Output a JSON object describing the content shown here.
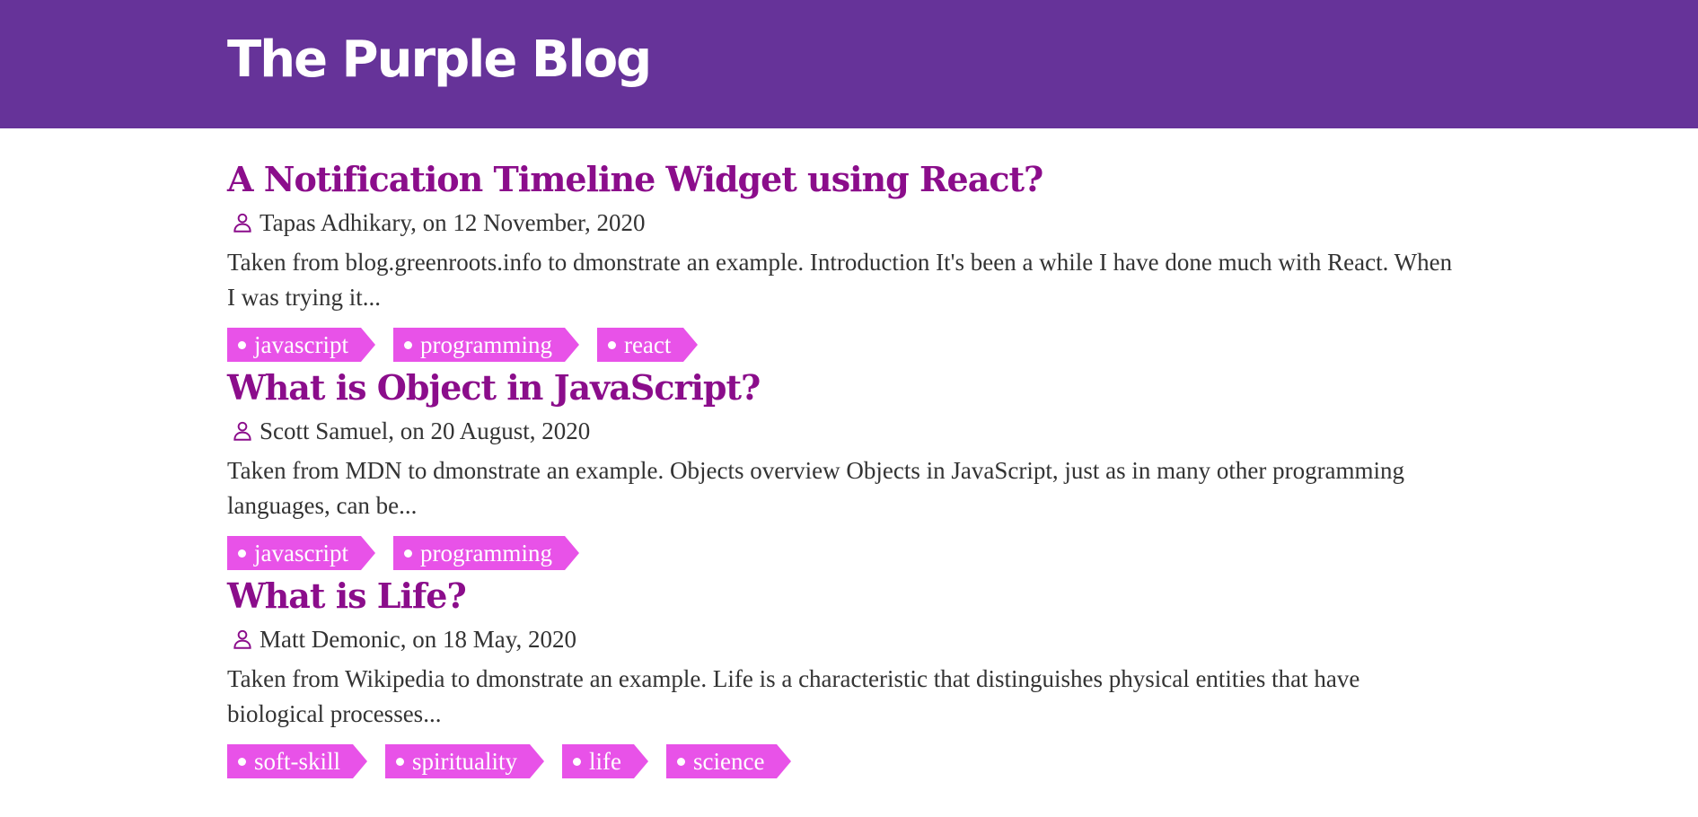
{
  "header": {
    "title": "The Purple Blog"
  },
  "colors": {
    "header_bg": "#663399",
    "title_color": "#8b0d8b",
    "tag_bg": "#e852e8",
    "text": "#333333"
  },
  "posts": [
    {
      "title": "A Notification Timeline Widget using React?",
      "meta": "Tapas Adhikary, on 12 November, 2020",
      "excerpt": "Taken from blog.greenroots.info to dmonstrate an example. Introduction It's been a while I have done much with React. When I was trying it...",
      "tags": [
        "javascript",
        "programming",
        "react"
      ]
    },
    {
      "title": "What is Object in JavaScript?",
      "meta": "Scott Samuel, on 20 August, 2020",
      "excerpt": "Taken from MDN to dmonstrate an example. Objects overview Objects in JavaScript, just as in many other programming languages, can be...",
      "tags": [
        "javascript",
        "programming"
      ]
    },
    {
      "title": "What is Life?",
      "meta": "Matt Demonic, on 18 May, 2020",
      "excerpt": "Taken from Wikipedia to dmonstrate an example. Life is a characteristic that distinguishes physical entities that have biological processes...",
      "tags": [
        "soft-skill",
        "spirituality",
        "life",
        "science"
      ]
    }
  ],
  "icons": {
    "author": "user-icon",
    "tag_bullet": "dot-icon"
  }
}
